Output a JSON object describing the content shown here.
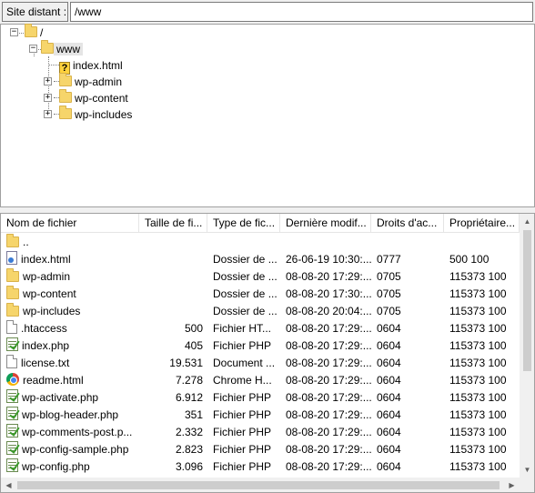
{
  "site": {
    "label": "Site distant :",
    "path": "/www"
  },
  "tree": {
    "root": "/",
    "www": "www",
    "children": [
      {
        "label": "index.html",
        "icon": "unknown-file-icon"
      },
      {
        "label": "wp-admin",
        "icon": "folder-icon"
      },
      {
        "label": "wp-content",
        "icon": "folder-icon"
      },
      {
        "label": "wp-includes",
        "icon": "folder-icon"
      }
    ]
  },
  "columns": [
    "Nom de fichier",
    "Taille de fi...",
    "Type de fic...",
    "Dernière modif...",
    "Droits d'ac...",
    "Propriétaire..."
  ],
  "files": [
    {
      "name": "..",
      "size": "",
      "type": "",
      "date": "",
      "perm": "",
      "owner": "",
      "icon": "folder"
    },
    {
      "name": "index.html",
      "size": "",
      "type": "Dossier de ...",
      "date": "26-06-19 10:30:...",
      "perm": "0777",
      "owner": "500 100",
      "icon": "html"
    },
    {
      "name": "wp-admin",
      "size": "",
      "type": "Dossier de ...",
      "date": "08-08-20 17:29:...",
      "perm": "0705",
      "owner": "115373 100",
      "icon": "folder"
    },
    {
      "name": "wp-content",
      "size": "",
      "type": "Dossier de ...",
      "date": "08-08-20 17:30:...",
      "perm": "0705",
      "owner": "115373 100",
      "icon": "folder"
    },
    {
      "name": "wp-includes",
      "size": "",
      "type": "Dossier de ...",
      "date": "08-08-20 20:04:...",
      "perm": "0705",
      "owner": "115373 100",
      "icon": "folder"
    },
    {
      "name": ".htaccess",
      "size": "500",
      "type": "Fichier HT...",
      "date": "08-08-20 17:29:...",
      "perm": "0604",
      "owner": "115373 100",
      "icon": "doc"
    },
    {
      "name": "index.php",
      "size": "405",
      "type": "Fichier PHP",
      "date": "08-08-20 17:29:...",
      "perm": "0604",
      "owner": "115373 100",
      "icon": "php"
    },
    {
      "name": "license.txt",
      "size": "19.531",
      "type": "Document ...",
      "date": "08-08-20 17:29:...",
      "perm": "0604",
      "owner": "115373 100",
      "icon": "doc"
    },
    {
      "name": "readme.html",
      "size": "7.278",
      "type": "Chrome H...",
      "date": "08-08-20 17:29:...",
      "perm": "0604",
      "owner": "115373 100",
      "icon": "chrome"
    },
    {
      "name": "wp-activate.php",
      "size": "6.912",
      "type": "Fichier PHP",
      "date": "08-08-20 17:29:...",
      "perm": "0604",
      "owner": "115373 100",
      "icon": "php"
    },
    {
      "name": "wp-blog-header.php",
      "size": "351",
      "type": "Fichier PHP",
      "date": "08-08-20 17:29:...",
      "perm": "0604",
      "owner": "115373 100",
      "icon": "php"
    },
    {
      "name": "wp-comments-post.p...",
      "size": "2.332",
      "type": "Fichier PHP",
      "date": "08-08-20 17:29:...",
      "perm": "0604",
      "owner": "115373 100",
      "icon": "php"
    },
    {
      "name": "wp-config-sample.php",
      "size": "2.823",
      "type": "Fichier PHP",
      "date": "08-08-20 17:29:...",
      "perm": "0604",
      "owner": "115373 100",
      "icon": "php"
    },
    {
      "name": "wp-config.php",
      "size": "3.096",
      "type": "Fichier PHP",
      "date": "08-08-20 17:29:...",
      "perm": "0604",
      "owner": "115373 100",
      "icon": "php"
    }
  ]
}
